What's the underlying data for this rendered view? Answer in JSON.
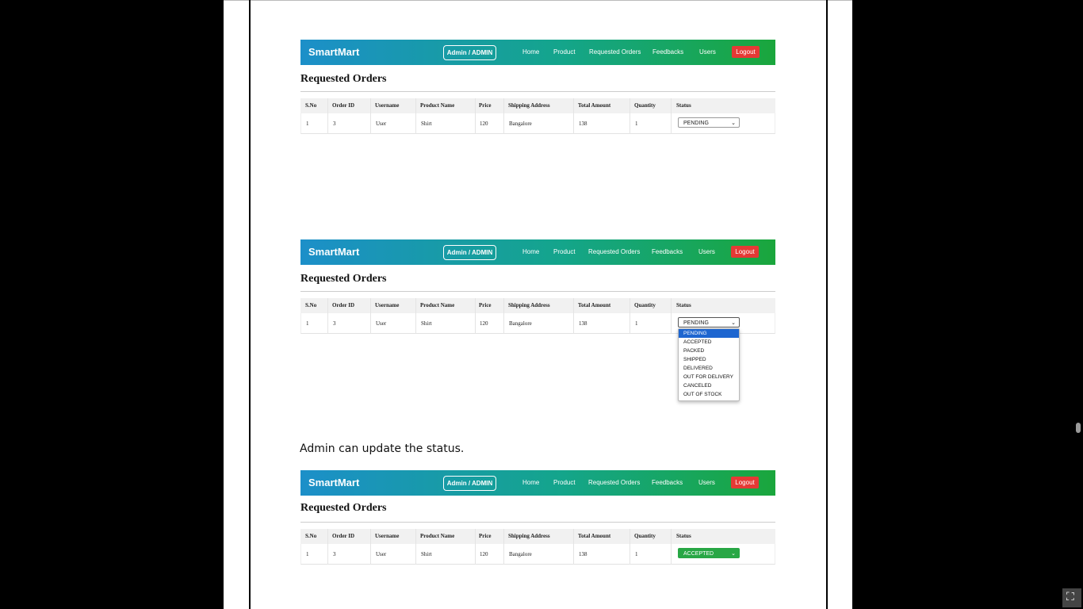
{
  "navbar": {
    "brand": "SmartMart",
    "admin_label": "Admin / ADMIN",
    "links": [
      "Home",
      "Product",
      "Requested Orders",
      "Feedbacks",
      "Users"
    ],
    "logout": "Logout"
  },
  "heading": "Requested Orders",
  "table": {
    "headers": [
      "S.No",
      "Order ID",
      "Username",
      "Product Name",
      "Price",
      "Shipping Address",
      "Total Amount",
      "Quantity",
      "Status"
    ],
    "row": [
      "1",
      "3",
      "User",
      "Shirt",
      "120",
      "Bangalore",
      "138",
      "1"
    ]
  },
  "status_values": [
    "PENDING",
    "PENDING",
    "ACCEPTED"
  ],
  "dropdown_options": [
    "PENDING",
    "ACCEPTED",
    "PACKED",
    "SHIPPED",
    "DELIVERED",
    "OUT FOR DELIVERY",
    "CANCELED",
    "OUT OF STOCK"
  ],
  "caption": "Admin can update the status.",
  "colors": {
    "navbar_start": "#1c8fc9",
    "navbar_end": "#1aa63c",
    "logout": "#e53935",
    "accepted": "#28a745",
    "selected_option": "#1e66d0"
  },
  "icons": {
    "fullscreen": "exit-fullscreen-icon"
  }
}
